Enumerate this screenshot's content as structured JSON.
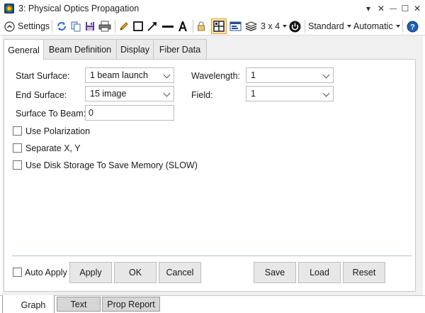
{
  "window": {
    "title": "3: Physical Optics Propagation",
    "controls": [
      "▾",
      "✕",
      "—",
      "☐",
      "✕"
    ]
  },
  "toolbar": {
    "settings_label": "Settings",
    "layout_label": "3 x 4",
    "standard_label": "Standard",
    "automatic_label": "Automatic"
  },
  "tabs": [
    {
      "label": "General",
      "active": true
    },
    {
      "label": "Beam Definition",
      "active": false
    },
    {
      "label": "Display",
      "active": false
    },
    {
      "label": "Fiber Data",
      "active": false
    }
  ],
  "general": {
    "start_surface": {
      "label": "Start Surface:",
      "value": "1 beam launch"
    },
    "end_surface": {
      "label": "End Surface:",
      "value": "15 image"
    },
    "surface_to_beam": {
      "label": "Surface To Beam:",
      "value": "0"
    },
    "wavelength": {
      "label": "Wavelength:",
      "value": "1"
    },
    "field": {
      "label": "Field:",
      "value": "1"
    },
    "checkboxes": [
      {
        "label": "Use Polarization",
        "checked": false
      },
      {
        "label": "Separate X, Y",
        "checked": false
      },
      {
        "label": "Use Disk Storage To Save Memory (SLOW)",
        "checked": false
      }
    ]
  },
  "buttons": {
    "auto_apply_label": "Auto Apply",
    "apply": "Apply",
    "ok": "OK",
    "cancel": "Cancel",
    "save": "Save",
    "load": "Load",
    "reset": "Reset"
  },
  "bottom_tabs": [
    {
      "label": "Graph",
      "active": true
    },
    {
      "label": "Text",
      "active": false
    },
    {
      "label": "Prop Report",
      "active": false
    }
  ],
  "colors": {
    "accent_blue": "#1c5fb8",
    "divider": "#a9c4d9",
    "active_toolbar_border": "#e8a317"
  }
}
